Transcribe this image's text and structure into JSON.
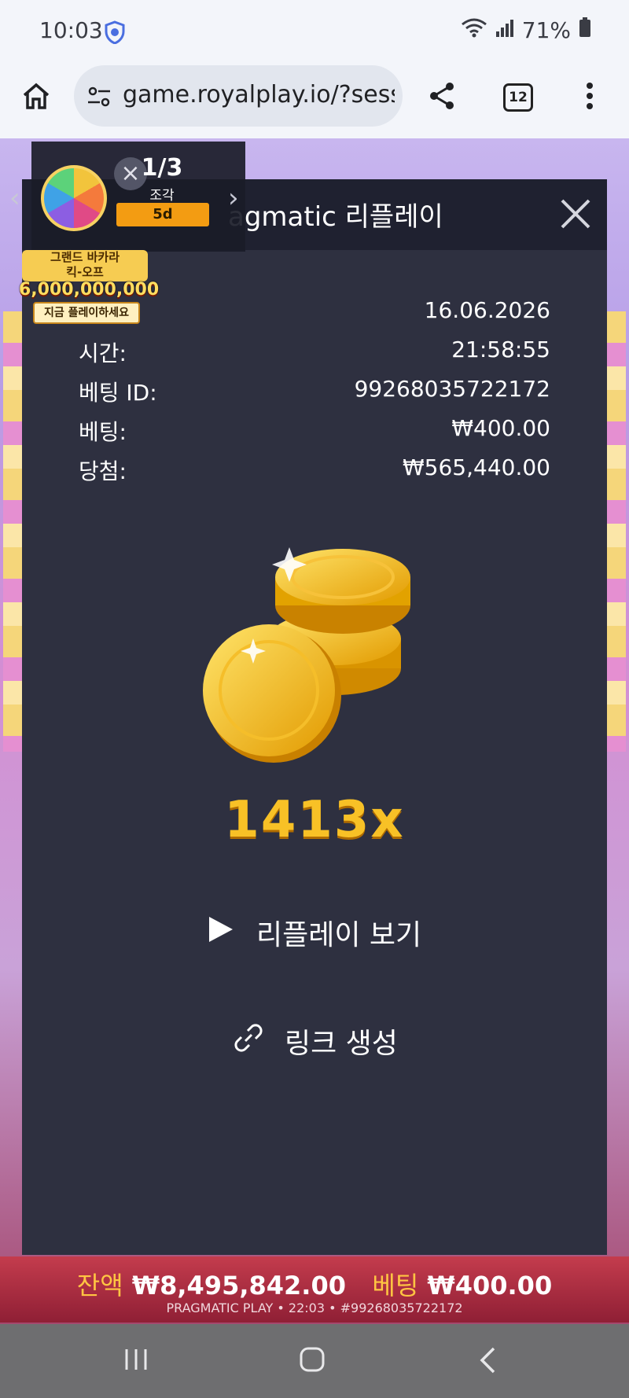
{
  "status_bar": {
    "time": "10:03",
    "battery": "71%",
    "icons": [
      "shield-icon",
      "wifi-icon",
      "signal-icon",
      "battery-icon"
    ]
  },
  "browser": {
    "url": "game.royalplay.io/?sessi",
    "tab_count": "12",
    "icons": [
      "home-icon",
      "site-settings-icon",
      "share-icon",
      "tab-switcher-icon",
      "more-menu-icon"
    ]
  },
  "promo": {
    "progress": "1/3",
    "pieces_label": "조각",
    "days_left": "5d",
    "badge_line1": "그랜드 바카라",
    "badge_line2": "킥-오프",
    "badge_amount": "6,000,000,000원",
    "badge_cta": "지금 플레이하세요"
  },
  "modal": {
    "title": "agmatic 리플레이",
    "date": "16.06.2026",
    "rows": [
      {
        "label": "시간:",
        "value": "21:58:55"
      },
      {
        "label": "베팅 ID:",
        "value": "99268035722172"
      },
      {
        "label": "베팅:",
        "value": "₩400.00"
      },
      {
        "label": "당첨:",
        "value": "₩565,440.00"
      }
    ],
    "multiplier": "1413x",
    "replay_label": "리플레이 보기",
    "link_label": "링크 생성"
  },
  "game_footer": {
    "balance_label": "잔액",
    "balance_value": "₩8,495,842.00",
    "bet_label": "베팅",
    "bet_value": "₩400.00",
    "provider_line": "PRAGMATIC PLAY • 22:03 • #99268035722172"
  },
  "nav": {
    "icons": [
      "recent-apps-icon",
      "home-button-icon",
      "back-icon"
    ]
  },
  "colors": {
    "modal_bg": "#2e3040",
    "modal_header": "#1f2130",
    "multiplier": "#f8c126",
    "accent_badge": "#f39c12"
  }
}
